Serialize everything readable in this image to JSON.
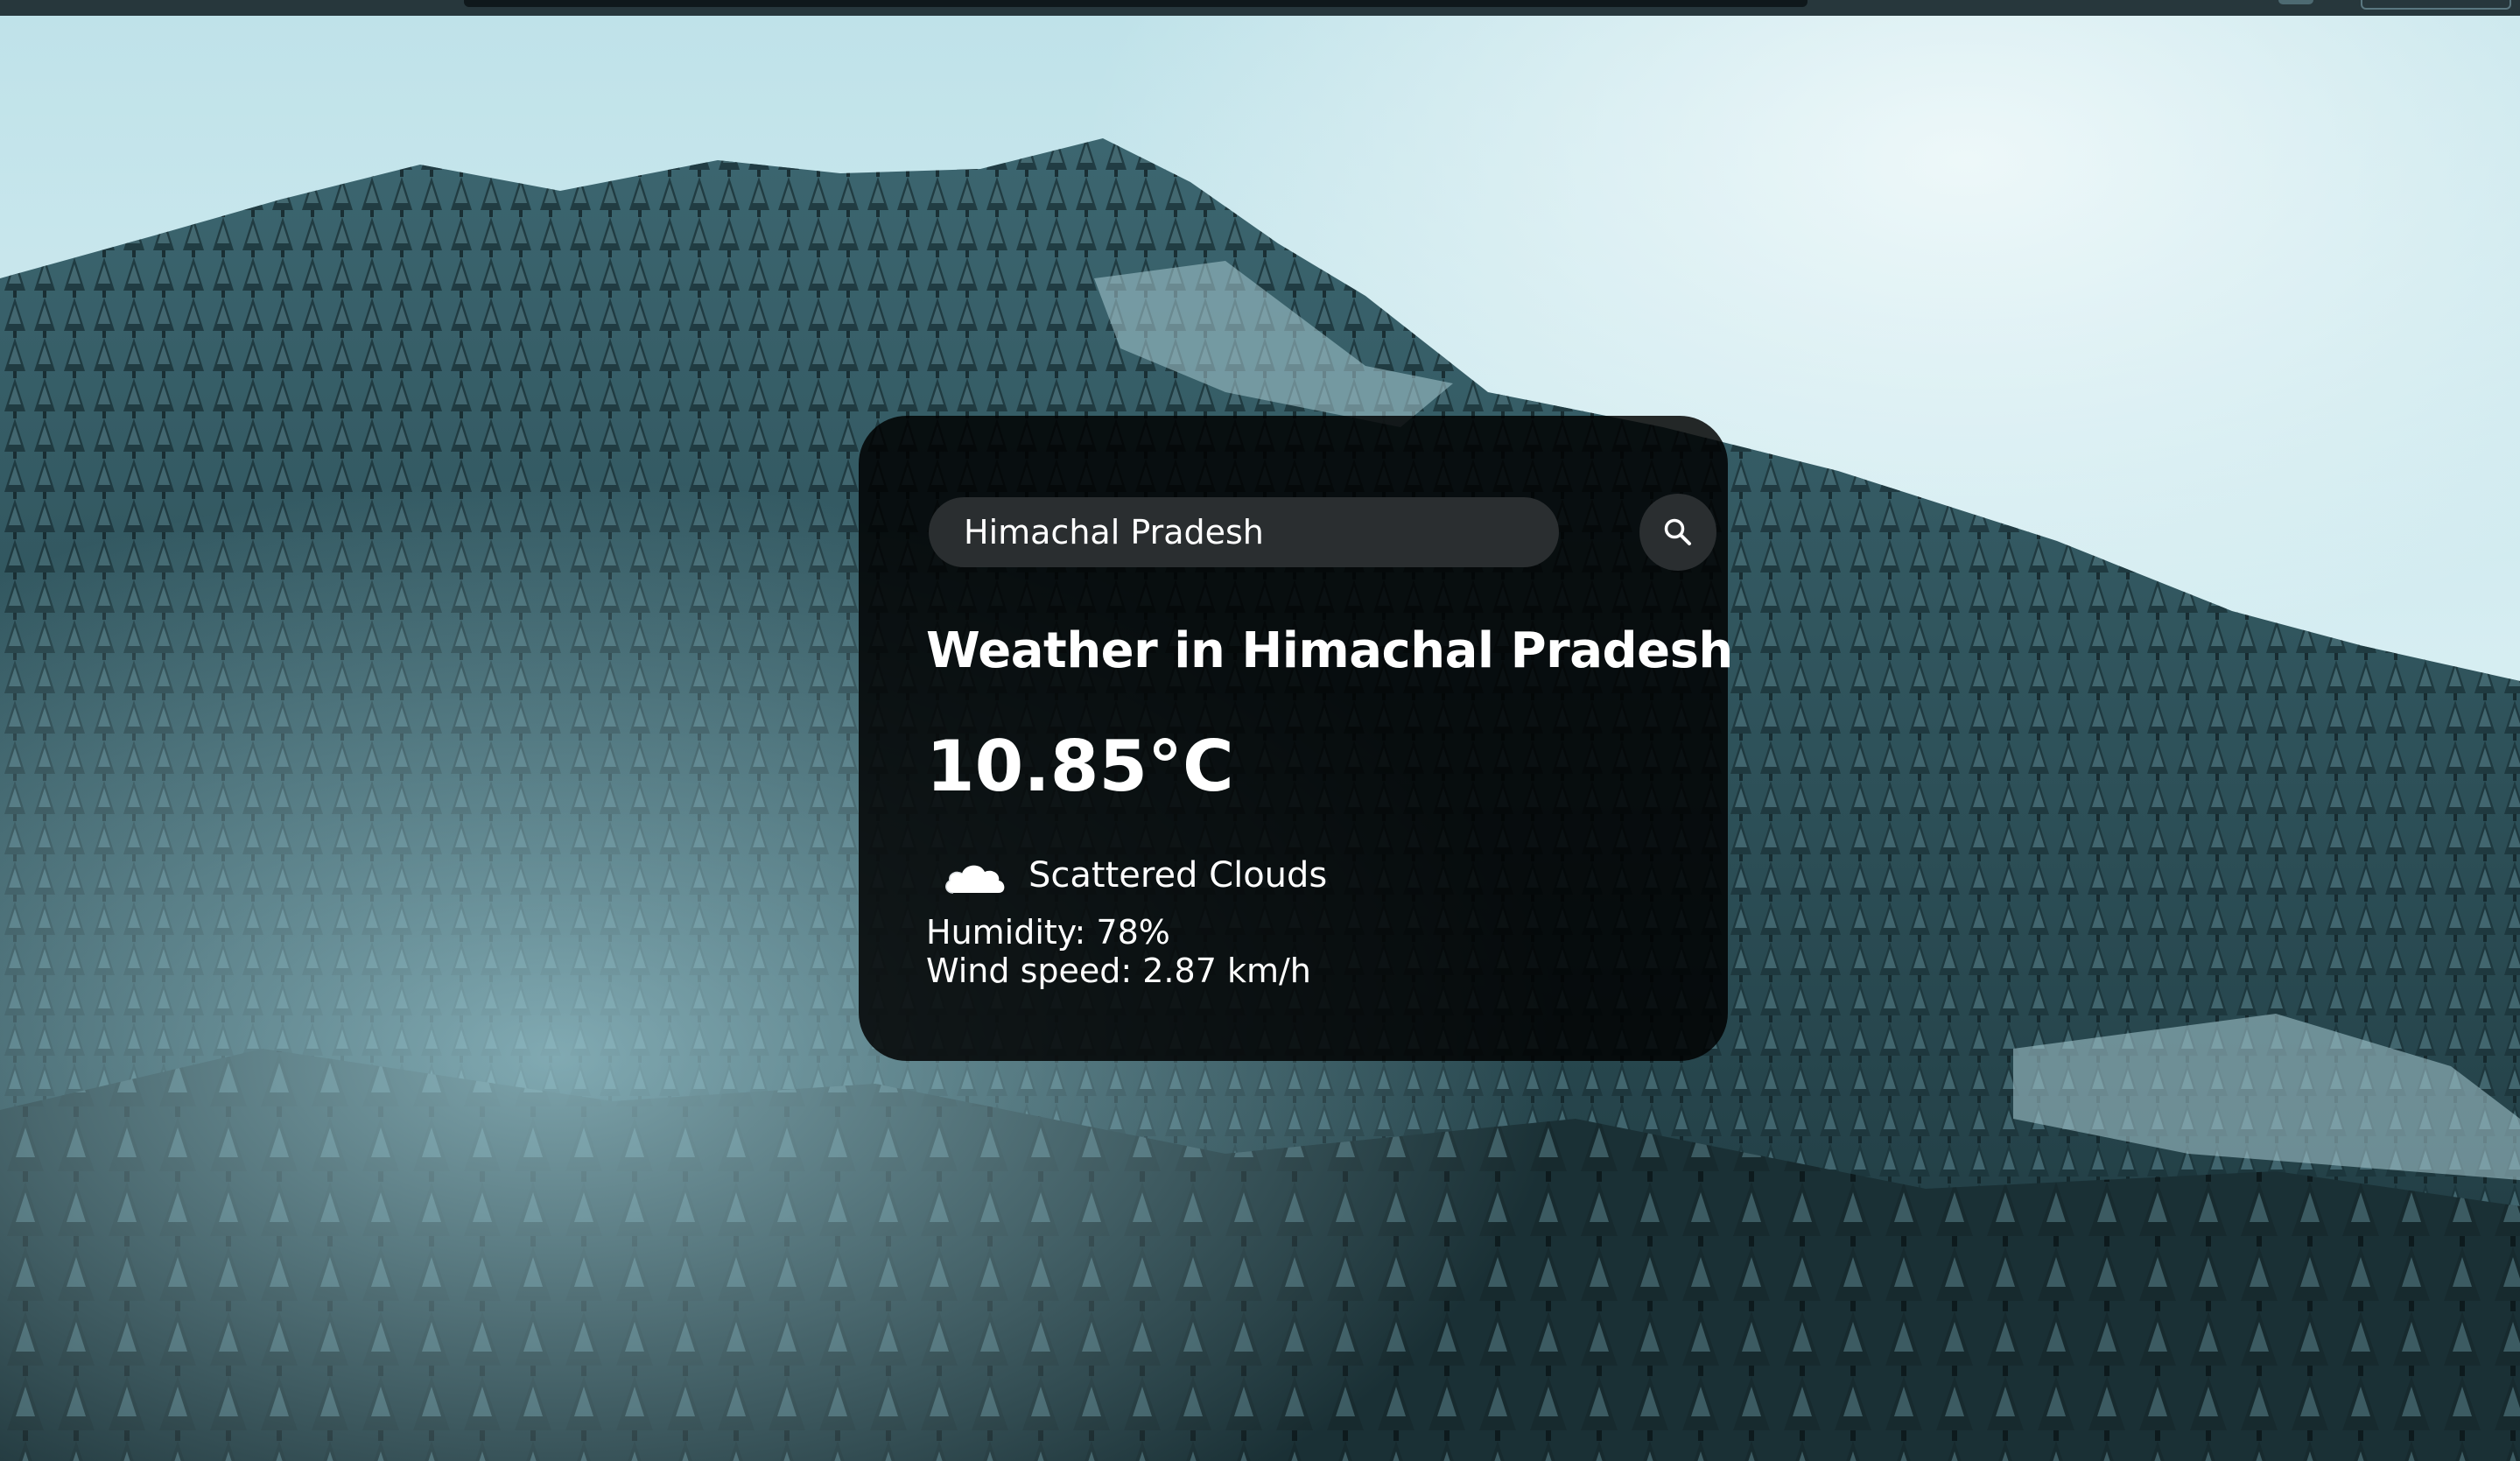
{
  "search": {
    "value": "Himachal Pradesh",
    "button_icon": "search-icon"
  },
  "weather": {
    "title": "Weather in Himachal Pradesh",
    "temperature": "10.85°C",
    "condition": "Scattered Clouds",
    "condition_icon": "cloud-icon",
    "humidity": "Humidity: 78%",
    "wind": "Wind speed: 2.87 km/h"
  },
  "colors": {
    "card_background": "#000000",
    "text": "#ffffff",
    "input_background": "#2a2e30"
  }
}
